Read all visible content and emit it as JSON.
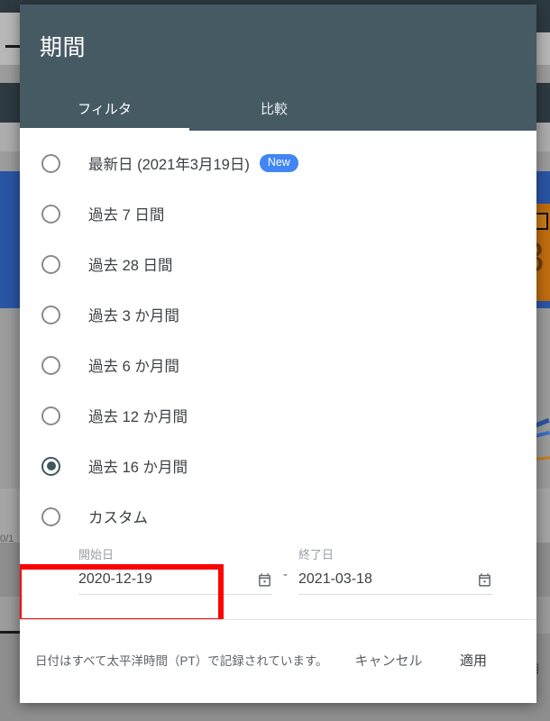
{
  "modal": {
    "title": "期間",
    "tabs": [
      {
        "label": "フィルタ",
        "active": true
      },
      {
        "label": "比較",
        "active": false
      }
    ],
    "options": [
      {
        "label": "最新日 (2021年3月19日)",
        "badge": "New",
        "selected": false
      },
      {
        "label": "過去 7 日間",
        "selected": false
      },
      {
        "label": "過去 28 日間",
        "selected": false
      },
      {
        "label": "過去 3 か月間",
        "selected": false
      },
      {
        "label": "過去 6 か月間",
        "selected": false
      },
      {
        "label": "過去 12 か月間",
        "selected": false
      },
      {
        "label": "過去 16 か月間",
        "selected": true
      },
      {
        "label": "カスタム",
        "selected": false
      }
    ],
    "date_range": {
      "start": {
        "label": "開始日",
        "value": "2020-12-19",
        "icon": "calendar-icon"
      },
      "separator": "-",
      "end": {
        "label": "終了日",
        "value": "2021-03-18",
        "icon": "calendar-icon"
      }
    },
    "footer": {
      "note": "日付はすべて太平洋時間（PT）で記録されています。",
      "cancel_label": "キャンセル",
      "apply_label": "適用"
    }
  },
  "annotation": {
    "shape": "rectangle",
    "color": "#f90505",
    "targets_option": "過去 16 か月間"
  },
  "colors": {
    "header_bg": "#465a64",
    "badge_bg": "#4285f4",
    "radio_selected": "#41565f",
    "annotation": "#f90505",
    "backdrop": "#8a8a8a"
  },
  "background_page": {
    "visible_fragments": [
      "0/1",
      "目",
      "3"
    ]
  }
}
